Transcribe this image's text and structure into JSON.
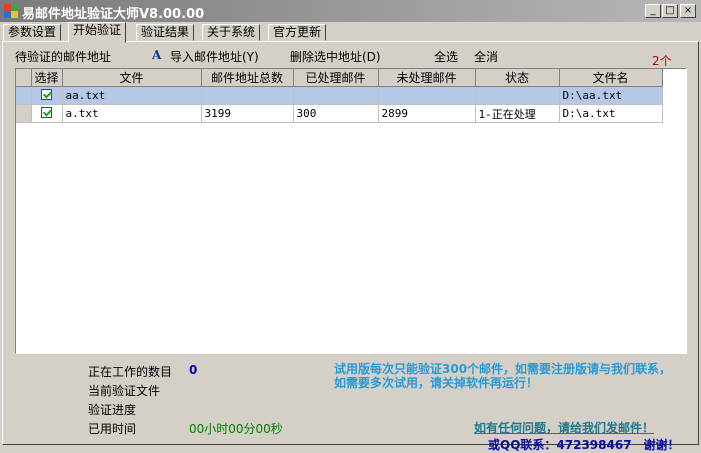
{
  "window": {
    "title": "易邮件地址验证大师V8.00.00",
    "min": "_",
    "max": "□",
    "close": "×"
  },
  "tabs": [
    {
      "label": "参数设置"
    },
    {
      "label": "开始验证"
    },
    {
      "label": "验证结果"
    },
    {
      "label": "关于系统"
    },
    {
      "label": "官方更新"
    }
  ],
  "toolbar": {
    "pending_label": "待验证的邮件地址",
    "import_icon_glyph": "A",
    "import_label": "导入邮件地址(Y)",
    "delete_label": "删除选中地址(D)",
    "select_all": "全选",
    "deselect_all": "全消",
    "count": "2个"
  },
  "table": {
    "columns": [
      "选择",
      "文件",
      "邮件地址总数",
      "已处理邮件",
      "未处理邮件",
      "状态",
      "文件名"
    ],
    "rows": [
      {
        "checked": true,
        "file": "aa.txt",
        "total": "",
        "processed": "",
        "unprocessed": "",
        "status": "",
        "filename": "D:\\aa.txt"
      },
      {
        "checked": true,
        "file": "a.txt",
        "total": "3199",
        "processed": "300",
        "unprocessed": "2899",
        "status": "1-正在处理",
        "filename": "D:\\a.txt"
      }
    ]
  },
  "status": {
    "working_label": "正在工作的数目",
    "working_value": "0",
    "current_file_label": "当前验证文件",
    "progress_label": "验证进度",
    "elapsed_label": "已用时间",
    "elapsed_value": "00小时00分00秒"
  },
  "notice": "试用版每次只能验证300个邮件，如需要注册版请与我们联系，如需要多次试用，请关掉软件再运行！",
  "contact": {
    "email_link": "如有任何问题，请给我们发邮件！",
    "qq": "或QQ联系：472398467　谢谢！"
  },
  "colors": {
    "selected_row": "#b5c8e8",
    "notice": "#2a9ad4",
    "count": "#c00000"
  }
}
